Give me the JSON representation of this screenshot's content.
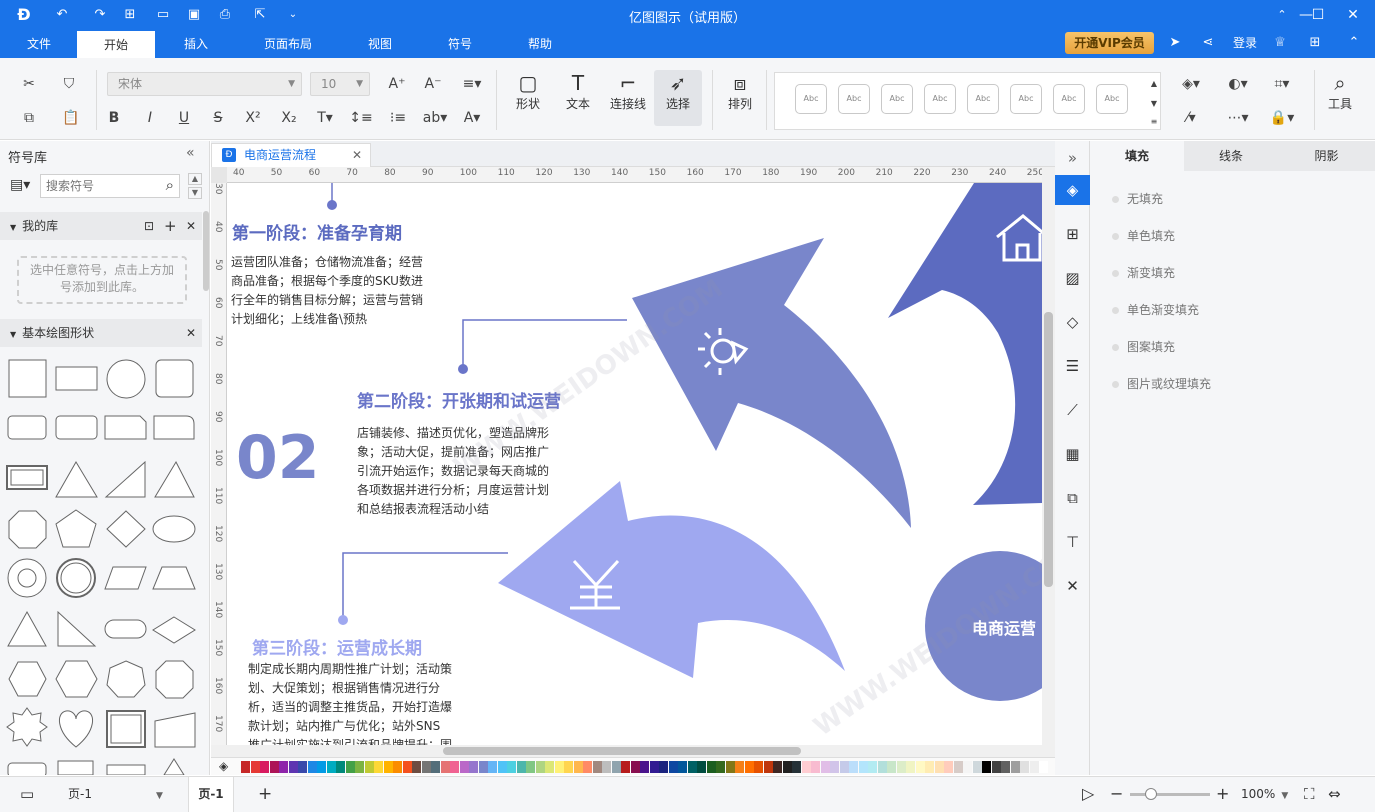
{
  "window": {
    "title": "亿图图示（试用版）"
  },
  "menu": {
    "items": [
      "文件",
      "开始",
      "插入",
      "页面布局",
      "视图",
      "符号",
      "帮助"
    ],
    "active_index": 1,
    "vip_label": "开通VIP会员",
    "login_label": "登录"
  },
  "toolbar": {
    "font_name": "宋体",
    "font_size": "10",
    "big_buttons": [
      "形状",
      "文本",
      "连接线",
      "选择"
    ],
    "arrange_label": "排列",
    "tools_label": "工具",
    "style_preview_label": "Abc"
  },
  "left_panel": {
    "title": "符号库",
    "search_placeholder": "搜索符号",
    "my_library": {
      "title": "我的库",
      "hint": "选中任意符号，点击上方加号添加到此库。"
    },
    "basic_shapes": {
      "title": "基本绘图形状"
    }
  },
  "canvas": {
    "tab_label": "电商运营流程",
    "ruler_top": [
      "40",
      "50",
      "60",
      "70",
      "80",
      "90",
      "100",
      "110",
      "120",
      "130",
      "140",
      "150",
      "160",
      "170",
      "180",
      "190",
      "200",
      "210",
      "220",
      "230",
      "240",
      "250"
    ],
    "ruler_left": [
      "30",
      "40",
      "50",
      "60",
      "70",
      "80",
      "90",
      "100",
      "110",
      "120",
      "130",
      "140",
      "150",
      "160",
      "170"
    ],
    "stage1": {
      "title": "第一阶段：准备孕育期",
      "lines": [
        "运营团队准备；仓储物流准备；经营",
        "商品准备；根据每个季度的SKU数进",
        "行全年的销售目标分解；运营与营销",
        "计划细化；上线准备\\预热"
      ]
    },
    "stage2": {
      "number": "02",
      "title": "第二阶段：开张期和试运营",
      "lines": [
        "店铺装修、描述页优化，塑造品牌形",
        "象；活动大促，提前准备；网店推广",
        "引流开始运作；数据记录每天商城的",
        "各项数据并进行分析；月度运营计划",
        "和总结报表流程活动小结"
      ]
    },
    "stage3": {
      "title": "第三阶段：运营成长期",
      "lines": [
        "制定成长期内周期性推广计划；活动策",
        "划、大促策划；根据销售情况进行分",
        "析，适当的调整主推货品，开始打造爆",
        "款计划；站内推广与优化；站外SNS",
        "推广计划实施达到引流和品牌提升；围"
      ]
    },
    "circle_label": "电商运营",
    "watermark": "WWW.WEIDOWN.COM"
  },
  "right_panel": {
    "tabs": [
      "填充",
      "线条",
      "阴影"
    ],
    "active_tab": 0,
    "fill_options": [
      "无填充",
      "单色填充",
      "渐变填充",
      "单色渐变填充",
      "图案填充",
      "图片或纹理填充"
    ]
  },
  "status": {
    "page_selector": "页-1",
    "page_tab": "页-1",
    "zoom": "100%"
  },
  "colors": {
    "accent": "#1a73e8",
    "arrow_dark": "#5c6bc0",
    "arrow_mid": "#7986cb",
    "arrow_light": "#9fa8f0",
    "text_blue": "#6a75c9"
  },
  "palette": [
    "#c62828",
    "#e53935",
    "#d81b60",
    "#ad1457",
    "#8e24aa",
    "#5e35b1",
    "#3949ab",
    "#1e88e5",
    "#039be5",
    "#00acc1",
    "#00897b",
    "#43a047",
    "#7cb342",
    "#c0ca33",
    "#fdd835",
    "#ffb300",
    "#fb8c00",
    "#f4511e",
    "#6d4c41",
    "#757575",
    "#546e7a",
    "#e57373",
    "#f06292",
    "#ba68c8",
    "#9575cd",
    "#7986cb",
    "#64b5f6",
    "#4fc3f7",
    "#4dd0e1",
    "#4db6ac",
    "#81c784",
    "#aed581",
    "#dce775",
    "#fff176",
    "#ffd54f",
    "#ffb74d",
    "#ff8a65",
    "#a1887f",
    "#bdbdbd",
    "#90a4ae",
    "#b71c1c",
    "#880e4f",
    "#4a148c",
    "#311b92",
    "#1a237e",
    "#0d47a1",
    "#01579b",
    "#006064",
    "#004d40",
    "#1b5e20",
    "#33691e",
    "#827717",
    "#f57f17",
    "#ff6f00",
    "#e65100",
    "#bf360c",
    "#3e2723",
    "#212121",
    "#263238",
    "#ffcdd2",
    "#f8bbd0",
    "#e1bee7",
    "#d1c4e9",
    "#c5cae9",
    "#bbdefb",
    "#b3e5fc",
    "#b2ebf2",
    "#b2dfdb",
    "#c8e6c9",
    "#dcedc8",
    "#f0f4c3",
    "#fff9c4",
    "#ffecb3",
    "#ffe0b2",
    "#ffccbc",
    "#d7ccc8",
    "#f5f5f5",
    "#cfd8dc",
    "#000000",
    "#424242",
    "#616161",
    "#9e9e9e",
    "#e0e0e0",
    "#eeeeee",
    "#ffffff"
  ]
}
